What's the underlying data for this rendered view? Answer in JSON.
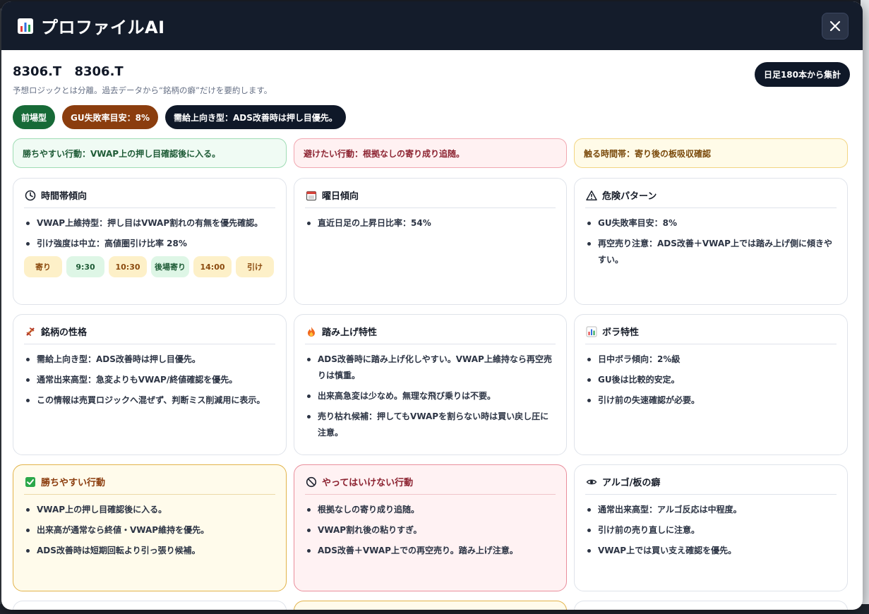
{
  "window": {
    "title": "プロファイルAI",
    "close_label": "×"
  },
  "header": {
    "ticker": "8306.T 8306.T",
    "subtitle": "予想ロジックとは分離。過去データから“銘柄の癖”だけを要約します。",
    "range_pill": "日足180本から集計"
  },
  "tags": [
    {
      "label": "前場型",
      "color": "#176a37"
    },
    {
      "label": "GU失敗率目安：8%",
      "color": "#8b3d0e"
    },
    {
      "label": "需給上向き型：ADS改善時は押し目優先。",
      "color": "#0f1828"
    }
  ],
  "notes": {
    "good": "勝ちやすい行動：VWAP上の押し目確認後に入る。",
    "bad": "避けたい行動：根拠なしの寄り成り追随。",
    "time": "触る時間帯：寄り後の板吸収確認"
  },
  "cards": {
    "time": {
      "title": "時間帯傾向",
      "icon": "clock-icon",
      "items": [
        "VWAP上維持型：押し目はVWAP割れの有無を優先確認。",
        "引け強度は中立：高値圏引け比率 28%"
      ],
      "slots": [
        {
          "label": "寄り",
          "tone": "y"
        },
        {
          "label": "9:30",
          "tone": "g"
        },
        {
          "label": "10:30",
          "tone": "y"
        },
        {
          "label": "後場寄り",
          "tone": "g"
        },
        {
          "label": "14:00",
          "tone": "y"
        },
        {
          "label": "引け",
          "tone": "y"
        }
      ]
    },
    "weekday": {
      "title": "曜日傾向",
      "icon": "calendar-icon",
      "items": [
        "直近日足の上昇日比率：54%"
      ]
    },
    "danger": {
      "title": "危険パターン",
      "icon": "warning-icon",
      "items": [
        "GU失敗率目安：8%",
        "再空売り注意：ADS改善＋VWAP上では踏み上げ側に傾きやすい。"
      ]
    },
    "character": {
      "title": "銘柄の性格",
      "icon": "dna-icon",
      "items": [
        "需給上向き型：ADS改善時は押し目優先。",
        "通常出来高型：急変よりもVWAP/終値確認を優先。",
        "この情報は売買ロジックへ混ぜず、判断ミス削減用に表示。"
      ]
    },
    "squeeze": {
      "title": "踏み上げ特性",
      "icon": "fire-icon",
      "items": [
        "ADS改善時に踏み上げ化しやすい。VWAP上維持なら再空売りは慎重。",
        "出来高急変は少なめ。無理な飛び乗りは不要。",
        "売り枯れ候補：押してもVWAPを割らない時は買い戻し圧に注意。"
      ]
    },
    "vola": {
      "title": "ボラ特性",
      "icon": "chart-icon",
      "items": [
        "日中ボラ傾向：2%級",
        "GU後は比較的安定。",
        "引け前の失速確認が必要。"
      ]
    },
    "win": {
      "title": "勝ちやすい行動",
      "icon": "check-icon",
      "items": [
        "VWAP上の押し目確認後に入る。",
        "出来高が通常なら終値・VWAP維持を優先。",
        "ADS改善時は短期回転より引っ張り候補。"
      ]
    },
    "nogo": {
      "title": "やってはいけない行動",
      "icon": "prohibited-icon",
      "items": [
        "根拠なしの寄り成り追随。",
        "VWAP割れ後の粘りすぎ。",
        "ADS改善＋VWAP上での再空売り。踏み上げ注意。"
      ]
    },
    "algo": {
      "title": "アルゴ/板の癖",
      "icon": "eye-icon",
      "items": [
        "通常出来高型：アルゴ反応は中程度。",
        "引け前の売り直しに注意。",
        "VWAP上では買い支え確認を優先。"
      ]
    }
  }
}
